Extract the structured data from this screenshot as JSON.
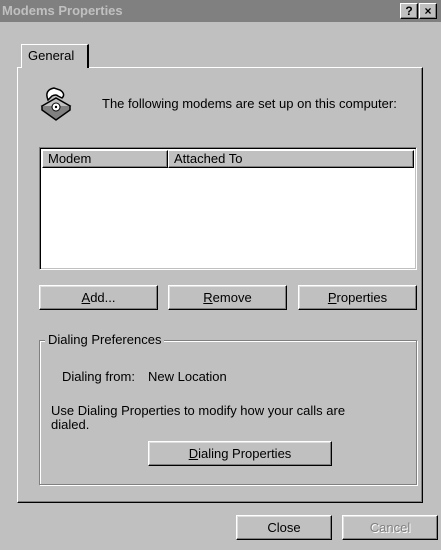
{
  "window": {
    "title": "Modems Properties",
    "help_label": "?",
    "close_label": "×"
  },
  "tabs": [
    {
      "label": "General"
    }
  ],
  "intro": {
    "icon": "telephone-icon",
    "text": "The following modems are set up on this computer:"
  },
  "modem_list": {
    "columns": [
      "Modem",
      "Attached To"
    ],
    "rows": []
  },
  "buttons": {
    "add": {
      "accel": "A",
      "rest": "dd..."
    },
    "remove": {
      "accel": "R",
      "rest": "emove"
    },
    "properties": {
      "accel": "P",
      "rest": "roperties"
    },
    "dialing_properties": {
      "accel": "D",
      "rest": "ialing Properties"
    },
    "close": "Close",
    "cancel": "Cancel"
  },
  "dialing_preferences": {
    "title": "Dialing Preferences",
    "dialing_from_label": "Dialing from:",
    "dialing_from_value": "New Location",
    "instructions": "Use Dialing Properties to modify how your calls are dialed."
  },
  "colors": {
    "face": "#c0c0c0",
    "shadow": "#808080",
    "highlight": "#ffffff",
    "title_inactive": "#808080"
  }
}
